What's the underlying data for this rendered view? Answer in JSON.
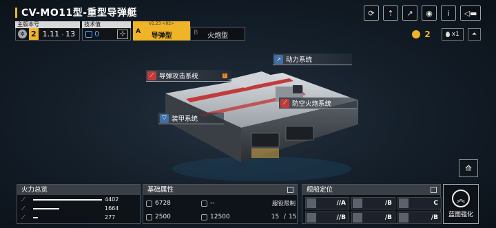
{
  "header": {
    "title": "CV-MO11型-重型导弹艇",
    "accent_color": "#f0b429"
  },
  "top_icons": [
    "refresh-icon",
    "share-icon",
    "external-link-icon",
    "eye-icon",
    "info-icon",
    "back-icon"
  ],
  "info": {
    "main_version_label": "主版本号",
    "level": "2",
    "version_major": "1.11",
    "version_minor": "13",
    "tech_label": "技术值",
    "tech_value": "0"
  },
  "tabs": [
    {
      "letter": "A",
      "label": "导弹型",
      "version": "V1.23 <02>"
    },
    {
      "letter": "B",
      "label": "火炮型"
    }
  ],
  "right_info": {
    "medal_count": "2",
    "drop_count": "x1"
  },
  "systems": {
    "power": "动力系统",
    "missile": "导弹攻击系统",
    "aa": "防空火炮系统",
    "armor": "装甲系统"
  },
  "firepower": {
    "title": "火力总览",
    "rows": [
      {
        "value": "4402",
        "fraction": 1.0
      },
      {
        "value": "1664",
        "fraction": 0.38
      },
      {
        "value": "277",
        "fraction": 0.07
      }
    ]
  },
  "attributes": {
    "title": "基础属性",
    "hp": "6728",
    "armor": "--",
    "speed": "2500",
    "range": "12500",
    "service_label": "服役限制",
    "service_current": "15",
    "service_max": "15"
  },
  "positioning": {
    "title": "舰船定位",
    "cells": [
      {
        "value": "A",
        "prefix": "//"
      },
      {
        "value": "B",
        "prefix": "/"
      },
      {
        "value": "C",
        "prefix": ""
      },
      {
        "value": "B",
        "prefix": "//"
      },
      {
        "value": "B",
        "prefix": "/"
      },
      {
        "value": "B",
        "prefix": "/"
      }
    ]
  },
  "blueprint": {
    "label": "蓝图强化"
  }
}
